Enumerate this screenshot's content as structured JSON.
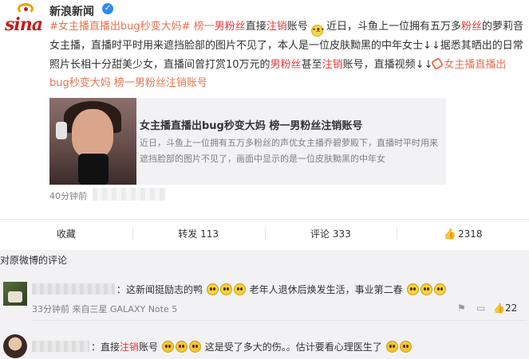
{
  "account": {
    "name": "新浪新闻",
    "logo_text": "sina"
  },
  "post": {
    "segments": [
      {
        "t": "#女主播直播出bug秒变大妈# 榜一",
        "c": "topic"
      },
      {
        "t": "男粉丝",
        "c": "hl"
      },
      {
        "t": "直接",
        "c": ""
      },
      {
        "t": "注销",
        "c": "hl"
      },
      {
        "t": "账号",
        "c": ""
      }
    ],
    "body1": "近日，斗鱼上一位拥有五万多",
    "body1_hl": "粉丝",
    "body2": "的萝莉音女主播，直播时平时用来遮挡脸部的图片不见了，本人是一位皮肤黝黑的中年女士↓↓据悉其晒出的日常照片长相十分甜美少女，直播间曾打赏10万元的",
    "body2_hl1": "男粉丝",
    "body3": "甚至",
    "body3_hl": "注销",
    "body4": "账号，直播视频↓↓",
    "link_text": "女主播直播出bug秒变大妈 榜一男粉丝注销账号"
  },
  "card": {
    "title": "女主播直播出bug秒变大妈 榜一男粉丝注销账号",
    "desc": "近日，斗鱼上一位拥有五万多粉丝的声优女主播乔碧萝殿下，直播时平时用来遮挡脸部的图片不见了，画面中显示的是一位皮肤黝黑的中年女"
  },
  "time": "40分钟前",
  "actions": {
    "collect": "收藏",
    "repost": "转发 113",
    "comment": "评论 333",
    "like": "2318"
  },
  "comments_header": "对原微博的评论",
  "comments": [
    {
      "text_a": "：这新闻挺励志的鸭",
      "text_b": "老年人退休后焕发生活，事业第二春",
      "meta": "33分钟前 来自三星 GALAXY Note 5",
      "likes": "22"
    },
    {
      "text_a": "：直接",
      "text_hl": "注销",
      "text_b": "账号",
      "text_c": "这是受了多大的伤。。估计要看心理医生了"
    }
  ]
}
